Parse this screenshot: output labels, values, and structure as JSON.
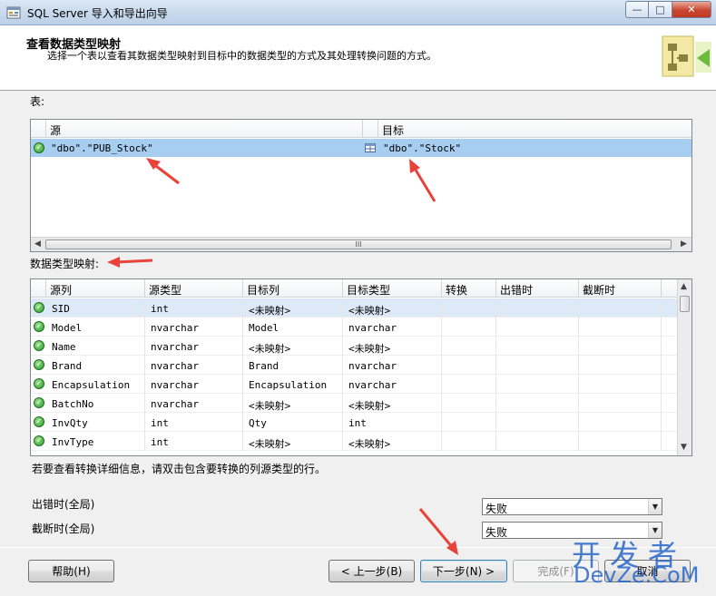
{
  "window": {
    "title": "SQL Server 导入和导出向导",
    "min_label": "—",
    "max_label": "□",
    "close_label": "✕"
  },
  "header": {
    "title": "查看数据类型映射",
    "description": "选择一个表以查看其数据类型映射到目标中的数据类型的方式及其处理转换问题的方式。"
  },
  "tables": {
    "label": "表:",
    "columns": [
      "源",
      "目标"
    ],
    "rows": [
      {
        "source": "\"dbo\".\"PUB_Stock\"",
        "target": "\"dbo\".\"Stock\""
      }
    ],
    "scroll_grip": "III"
  },
  "mapping": {
    "label": "数据类型映射:",
    "columns": [
      "源列",
      "源类型",
      "目标列",
      "目标类型",
      "转换",
      "出错时",
      "截断时"
    ],
    "rows": [
      {
        "src_col": "SID",
        "src_type": "int",
        "dst_col": "<未映射>",
        "dst_type": "<未映射>"
      },
      {
        "src_col": "Model",
        "src_type": "nvarchar",
        "dst_col": "Model",
        "dst_type": "nvarchar"
      },
      {
        "src_col": "Name",
        "src_type": "nvarchar",
        "dst_col": "<未映射>",
        "dst_type": "<未映射>"
      },
      {
        "src_col": "Brand",
        "src_type": "nvarchar",
        "dst_col": "Brand",
        "dst_type": "nvarchar"
      },
      {
        "src_col": "Encapsulation",
        "src_type": "nvarchar",
        "dst_col": "Encapsulation",
        "dst_type": "nvarchar"
      },
      {
        "src_col": "BatchNo",
        "src_type": "nvarchar",
        "dst_col": "<未映射>",
        "dst_type": "<未映射>"
      },
      {
        "src_col": "InvQty",
        "src_type": "int",
        "dst_col": "Qty",
        "dst_type": "int"
      },
      {
        "src_col": "InvType",
        "src_type": "int",
        "dst_col": "<未映射>",
        "dst_type": "<未映射>"
      }
    ]
  },
  "hint": "若要查看转换详细信息，请双击包含要转换的列源类型的行。",
  "global": {
    "on_error_label": "出错时(全局)",
    "on_error_value": "失败",
    "on_truncate_label": "截断时(全局)",
    "on_truncate_value": "失败"
  },
  "buttons": {
    "help": "帮助(H)",
    "back": "< 上一步(B)",
    "next": "下一步(N) >",
    "finish": "完成(F)",
    "cancel": "取消"
  },
  "watermark": {
    "cn": "开发者",
    "en": "DevZe.CoM"
  },
  "colors": {
    "selection": "#a7cdf0",
    "arrow": "#e8423a",
    "watermark": "#2966c9"
  }
}
